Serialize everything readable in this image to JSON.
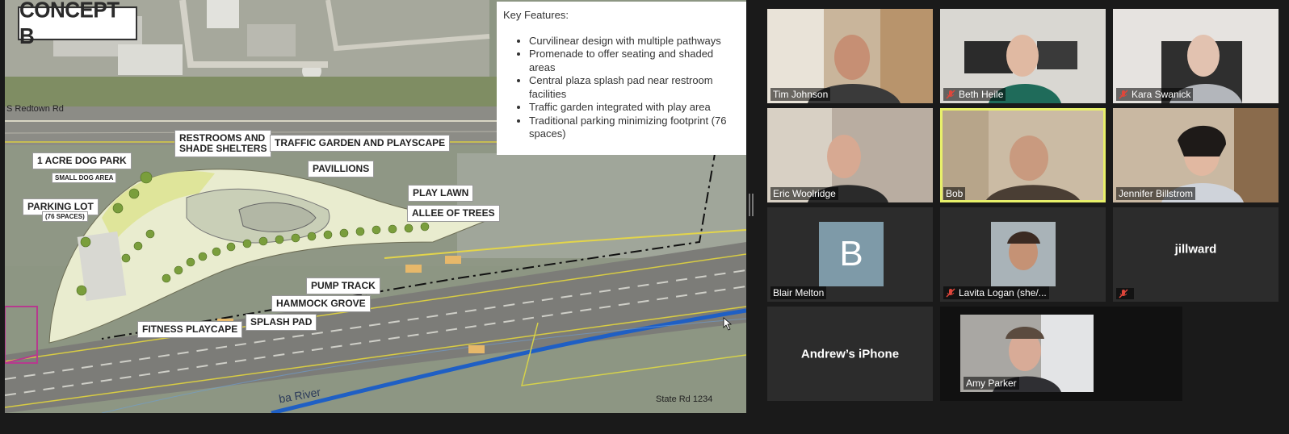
{
  "presentation": {
    "concept_label": "CONCEPT B",
    "road_top": "S Redtown Rd",
    "road_bottom": "State Rd 1234",
    "river": "ba River",
    "key_features": {
      "title": "Key Features:",
      "items": [
        "Curvilinear design with multiple pathways",
        "Promenade to offer seating and shaded areas",
        "Central plaza splash pad near restroom facilities",
        "Traffic garden integrated with play area",
        "Traditional parking minimizing footprint (76 spaces)"
      ]
    },
    "callouts": {
      "restrooms_line1": "RESTROOMS AND",
      "restrooms_line2": "SHADE SHELTERS",
      "traffic_garden": "TRAFFIC GARDEN AND PLAYSCAPE",
      "dog_park": "1 ACRE DOG PARK",
      "small_dog": "SMALL DOG AREA",
      "pavillions": "PAVILLIONS",
      "parking": "PARKING LOT",
      "parking_spaces": "(76 SPACES)",
      "play_lawn": "PLAY LAWN",
      "allee": "ALLEE OF TREES",
      "pump_track": "PUMP TRACK",
      "hammock": "HAMMOCK GROVE",
      "splash": "SPLASH PAD",
      "fitness": "FITNESS PLAYCAPE"
    }
  },
  "participants": [
    {
      "name": "Tim Johnson",
      "muted": false,
      "video": true
    },
    {
      "name": "Beth Heile",
      "muted": true,
      "video": true
    },
    {
      "name": "Kara Swanick",
      "muted": true,
      "video": true
    },
    {
      "name": "Eric Woolridge",
      "muted": false,
      "video": true
    },
    {
      "name": "Bob",
      "muted": false,
      "video": true,
      "active_speaker": true
    },
    {
      "name": "Jennifer Billstrom",
      "muted": false,
      "video": true
    },
    {
      "name": "Blair Melton",
      "muted": false,
      "video": false,
      "avatar_letter": "B"
    },
    {
      "name": "Lavita Logan (she/...",
      "muted": true,
      "video": true
    },
    {
      "name": "jillward",
      "muted": true,
      "video": false
    },
    {
      "name": "Andrew’s iPhone",
      "muted": false,
      "video": false
    },
    {
      "name": "Amy Parker",
      "muted": false,
      "video": true
    }
  ],
  "colors": {
    "active_speaker": "#e8f06a",
    "muted_icon": "#e0463b",
    "avatar_bg": "#7e9aa8"
  }
}
